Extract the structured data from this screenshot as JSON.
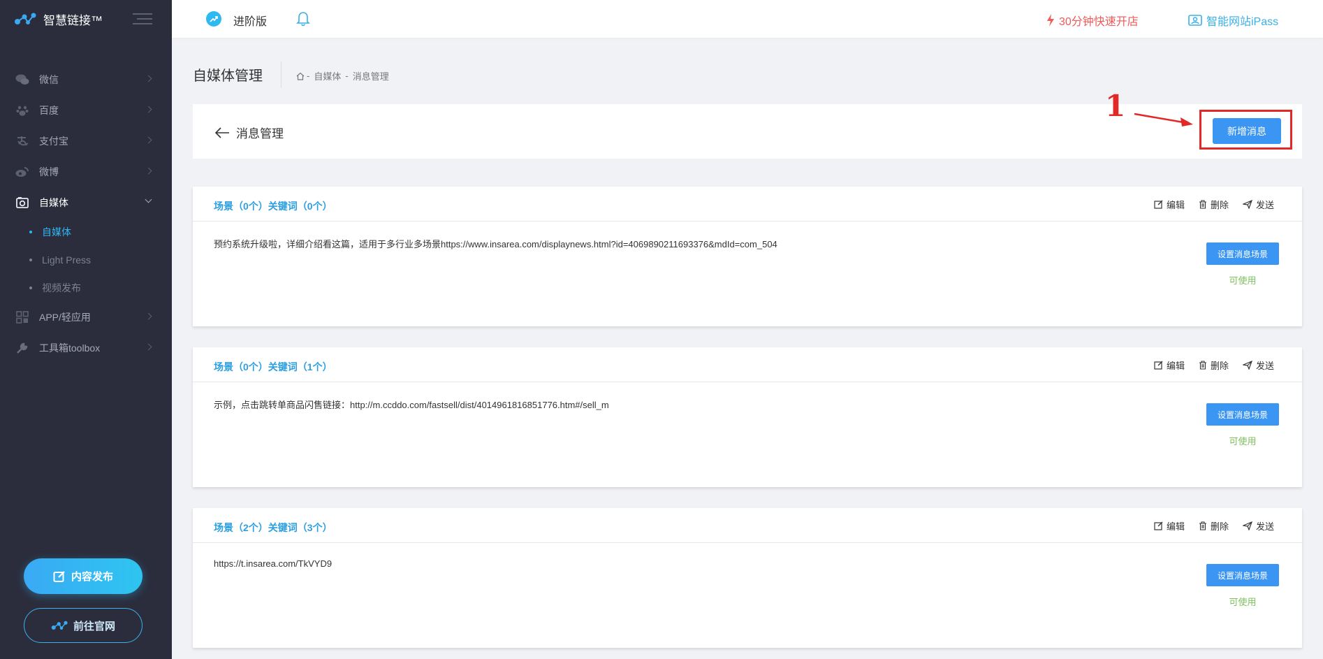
{
  "brand": {
    "name": "智慧链接™"
  },
  "sidebar": {
    "items": [
      {
        "label": "微信",
        "icon": "wechat-icon"
      },
      {
        "label": "百度",
        "icon": "paw-icon"
      },
      {
        "label": "支付宝",
        "icon": "alipay-icon"
      },
      {
        "label": "微博",
        "icon": "weibo-icon"
      },
      {
        "label": "自媒体",
        "icon": "camera-icon",
        "open": true
      },
      {
        "label": "APP/轻应用",
        "icon": "app-grid-icon"
      },
      {
        "label": "工具箱toolbox",
        "icon": "wrench-icon"
      }
    ],
    "subitems": [
      {
        "label": "自媒体",
        "active": true
      },
      {
        "label": "Light Press"
      },
      {
        "label": "视频发布"
      }
    ],
    "publish_label": "内容发布",
    "site_label": "前往官网"
  },
  "topbar": {
    "version": "进阶版",
    "quick_open": "30分钟快速开店",
    "ipass": "智能网站iPass"
  },
  "page": {
    "title": "自媒体管理",
    "breadcrumb": [
      "自媒体",
      "消息管理"
    ],
    "back_label": "消息管理",
    "new_button": "新增消息",
    "annotation": "1"
  },
  "cards": [
    {
      "label": "场景（0个）关键词（0个）",
      "text": "预约系统升级啦，详细介绍看这篇，适用于多行业多场景https://www.insarea.com/displaynews.html?id=4069890211693376&mdId=com_504",
      "button": "设置消息场景",
      "status": "可使用"
    },
    {
      "label": "场景（0个）关键词（1个）",
      "text": "示例，点击跳转单商品闪售链接：http://m.ccddo.com/fastsell/dist/4014961816851776.htm#/sell_m",
      "button": "设置消息场景",
      "status": "可使用"
    },
    {
      "label": "场景（2个）关键词（3个）",
      "text": "https://t.insarea.com/TkVYD9",
      "button": "设置消息场景",
      "status": "可使用"
    }
  ],
  "actions": {
    "edit": "编辑",
    "delete": "删除",
    "send": "发送"
  },
  "colors": {
    "sidebar": "#2b2d3c",
    "accent": "#2fb5f2",
    "primary_button": "#3b95f2",
    "alert": "#ef5a5a",
    "annotation": "#e32828",
    "status_ok": "#7cc15c"
  }
}
